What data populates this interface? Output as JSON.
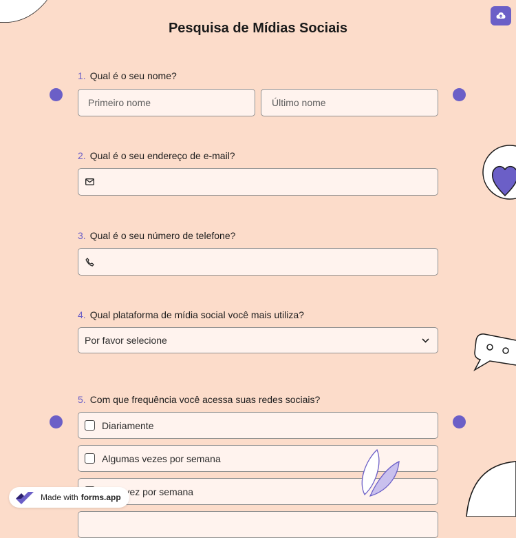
{
  "form": {
    "title": "Pesquisa de Mídias Sociais"
  },
  "questions": [
    {
      "number": "1.",
      "label": "Qual é o seu nome?",
      "first_placeholder": "Primeiro nome",
      "last_placeholder": "Último nome"
    },
    {
      "number": "2.",
      "label": "Qual é o seu endereço de e-mail?",
      "icon": "mail-icon",
      "value": ""
    },
    {
      "number": "3.",
      "label": "Qual é o seu número de telefone?",
      "icon": "phone-icon",
      "value": ""
    },
    {
      "number": "4.",
      "label": "Qual plataforma de mídia social você mais utiliza?",
      "selected": "Por favor selecione"
    },
    {
      "number": "5.",
      "label": "Com que frequência você acessa suas redes sociais?",
      "options": [
        "Diariamente",
        "Algumas vezes por semana",
        "Uma vez por semana"
      ]
    }
  ],
  "badge": {
    "prefix": "Made with",
    "brand": "forms.app"
  },
  "colors": {
    "background": "#fcdcca",
    "accent": "#6b5fc7",
    "field_bg": "#fff3ee"
  }
}
